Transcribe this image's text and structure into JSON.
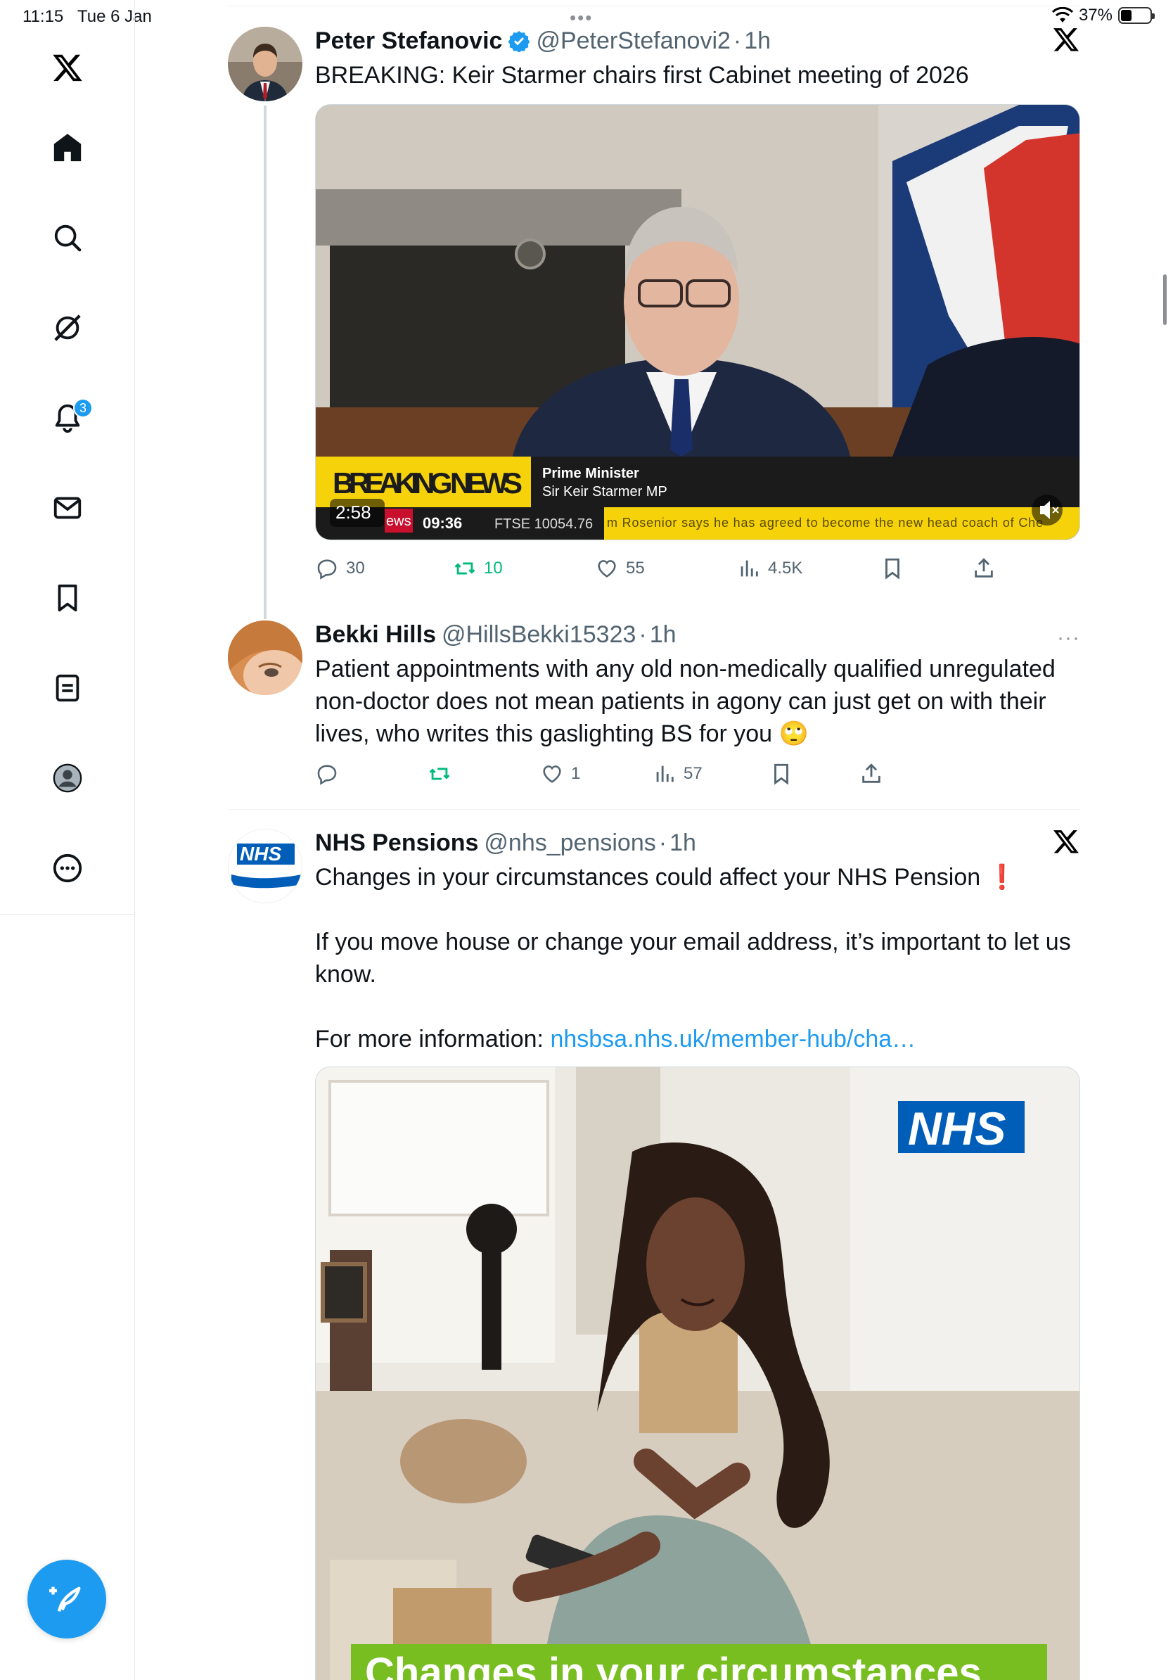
{
  "status": {
    "time": "11:15",
    "date": "Tue 6 Jan",
    "dots": "•••",
    "battery": "37%",
    "battery_level": 0.37
  },
  "sidebar": {
    "items": [
      {
        "name": "x-logo-icon"
      },
      {
        "name": "home-icon"
      },
      {
        "name": "search-icon"
      },
      {
        "name": "grok-icon"
      },
      {
        "name": "notifications-icon",
        "badge": "3"
      },
      {
        "name": "messages-icon"
      },
      {
        "name": "bookmarks-icon"
      },
      {
        "name": "lists-icon"
      },
      {
        "name": "profile-icon"
      },
      {
        "name": "more-icon"
      }
    ],
    "compose": "compose-icon"
  },
  "tweets": [
    {
      "name": "Peter Stefanovic",
      "handle": "@PeterStefanovi2",
      "dot": "·",
      "time": "1h",
      "verified": true,
      "text": "BREAKING: Keir Starmer chairs first Cabinet meeting of 2026",
      "video": {
        "banner": "BREAKING NEWS",
        "role": "Prime Minister",
        "person": "Sir Keir Starmer MP",
        "duration": "2:58",
        "logo": "ews",
        "clock": "09:36",
        "ticker_left": "FTSE 10054.76",
        "ticker": "m Rosenior says he has agreed to become the new head coach of Che"
      },
      "stats": {
        "replies": "30",
        "reposts": "10",
        "likes": "55",
        "views": "4.5K"
      }
    },
    {
      "name": "Bekki Hills",
      "handle": "@HillsBekki15323",
      "dot": "·",
      "time": "1h",
      "more": "···",
      "text": "Patient appointments with any old non-medically qualified unregulated non-doctor does not mean patients in agony can just get on with their lives, who writes this gaslighting BS for you 🙄",
      "stats": {
        "replies": "",
        "reposts": "",
        "likes": "1",
        "views": "57"
      }
    },
    {
      "name": "NHS Pensions",
      "handle": "@nhs_pensions",
      "dot": "·",
      "time": "1h",
      "avatar_logo": "NHS",
      "text_line1": "Changes in your circumstances could affect your NHS Pension ❗",
      "text_line2": "If you move house or change your email address, it’s important to let us know.",
      "text_line3_prefix": "For more information: ",
      "link": "nhsbsa.nhs.uk/member-hub/cha…",
      "image": {
        "logo": "NHS",
        "caption": "Changes in your circumstances"
      }
    }
  ],
  "colors": {
    "accent": "#1d9bf0",
    "repost": "#00ba7c",
    "muted": "#536471",
    "nhs_blue": "#005eb8",
    "nhs_green": "#78be20"
  }
}
